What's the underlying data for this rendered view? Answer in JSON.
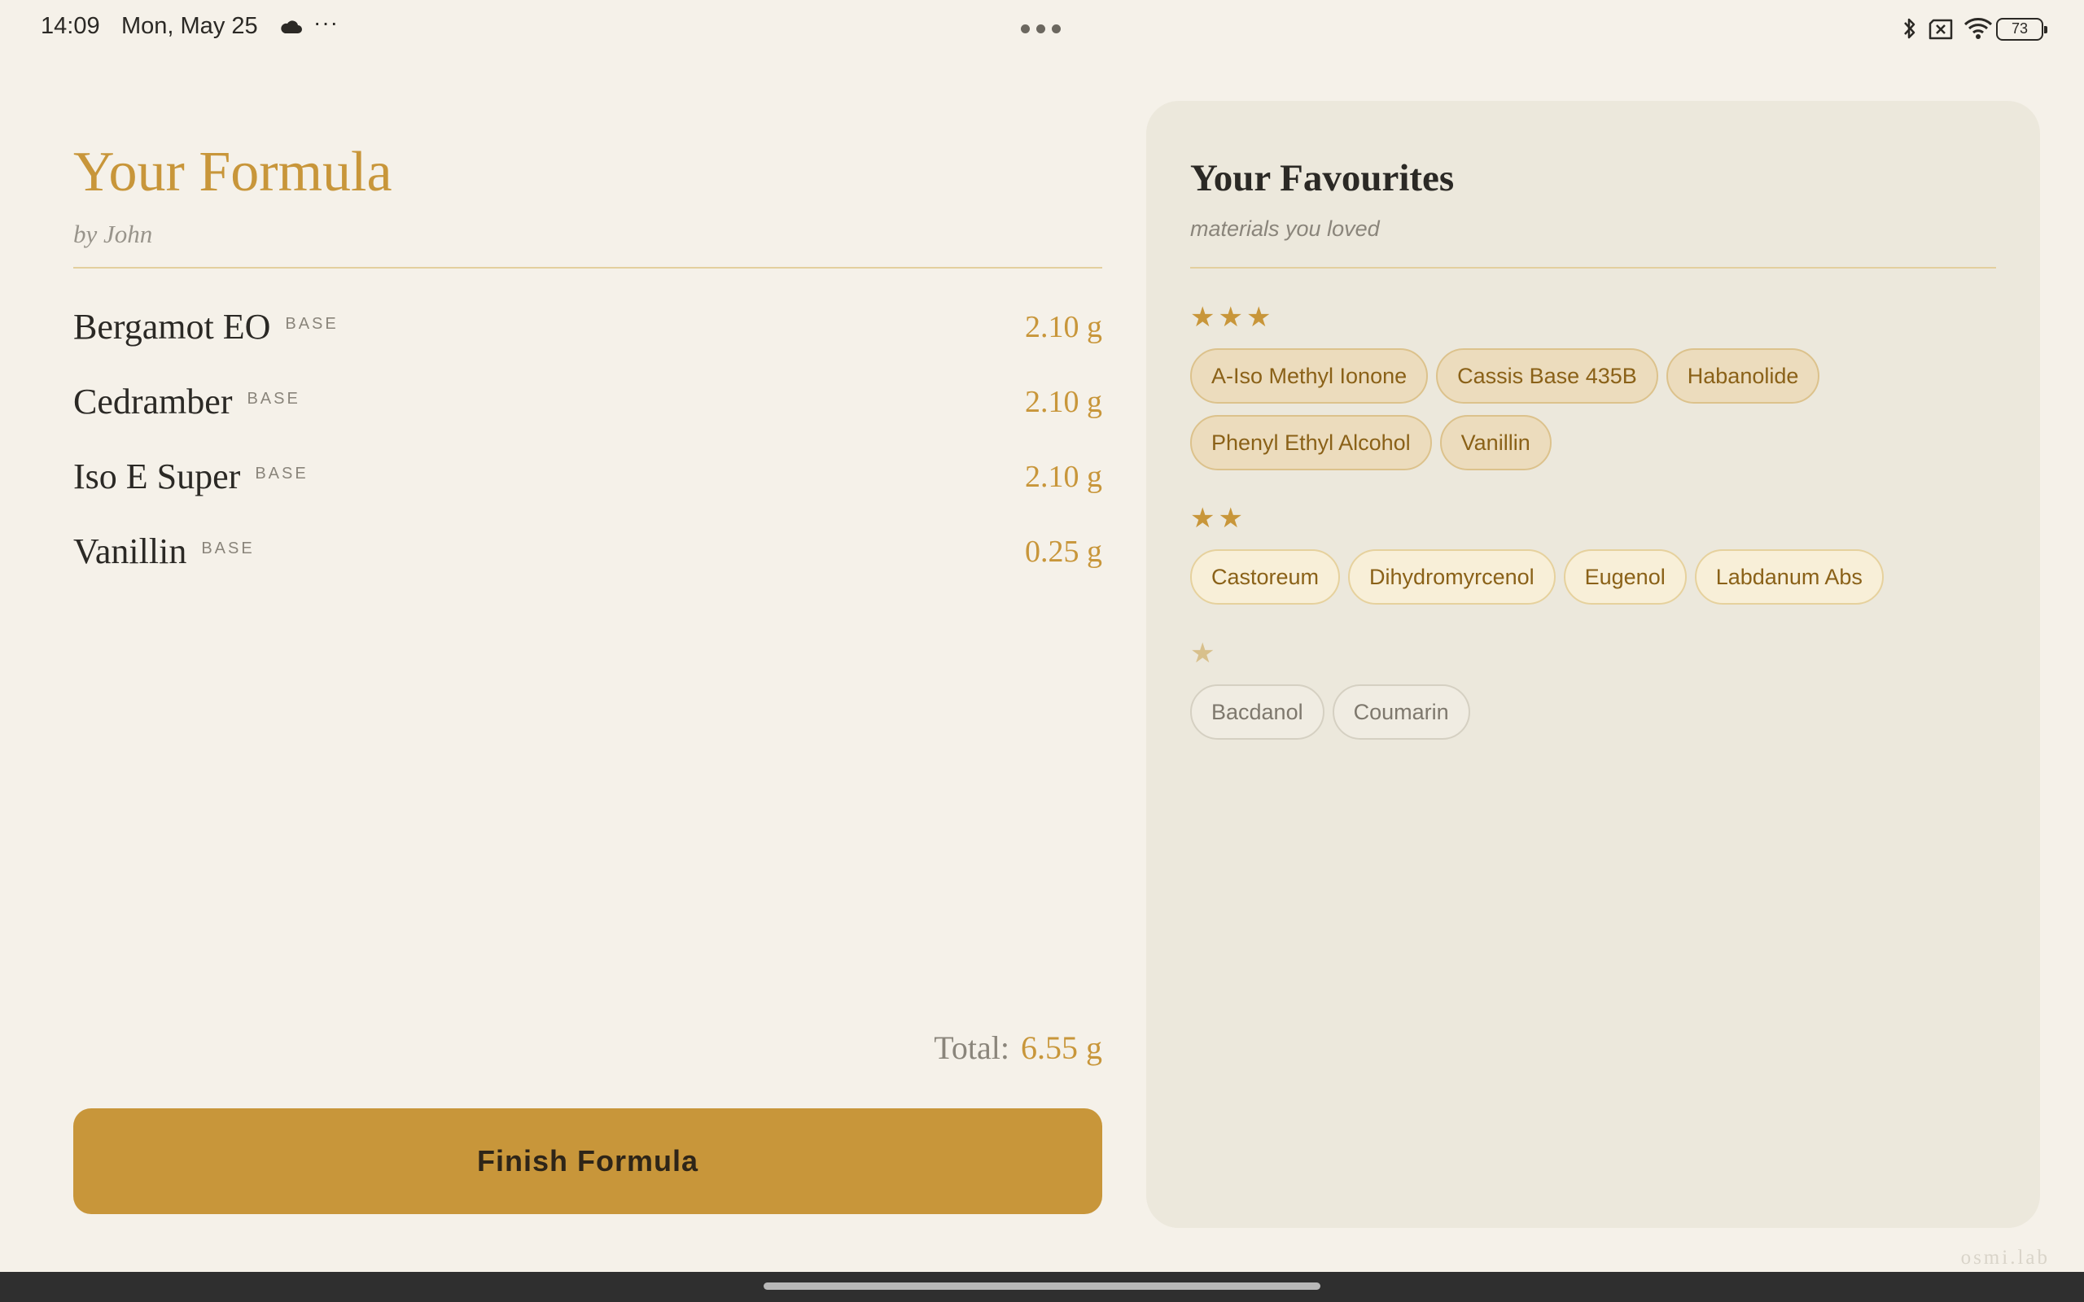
{
  "status_bar": {
    "time": "14:09",
    "date": "Mon, May 25",
    "weather_icon": "cloud-icon",
    "more": "···",
    "battery": "73",
    "icons": [
      "bluetooth-icon",
      "no-sim-icon",
      "wifi-icon",
      "battery-icon"
    ]
  },
  "formula": {
    "title": "Your Formula",
    "author": "by John",
    "items": [
      {
        "name": "Bergamot EO",
        "tag": "BASE",
        "amount": "2.10 g"
      },
      {
        "name": "Cedramber",
        "tag": "BASE",
        "amount": "2.10 g"
      },
      {
        "name": "Iso E Super",
        "tag": "BASE",
        "amount": "2.10 g"
      },
      {
        "name": "Vanillin",
        "tag": "BASE",
        "amount": "0.25 g"
      }
    ],
    "total_label": "Total:",
    "total_value": "6.55 g",
    "finish_label": "Finish Formula"
  },
  "favourites": {
    "title": "Your Favourites",
    "subtitle": "materials you loved",
    "groups": [
      {
        "stars": "★★★",
        "items": [
          "A-Iso Methyl Ionone",
          "Cassis Base 435B",
          "Habanolide",
          "Phenyl Ethyl Alcohol",
          "Vanillin"
        ]
      },
      {
        "stars": "★★",
        "items": [
          "Castoreum",
          "Dihydromyrcenol",
          "Eugenol",
          "Labdanum Abs"
        ]
      },
      {
        "stars": "★",
        "items": [
          "Bacdanol",
          "Coumarin"
        ]
      }
    ]
  },
  "watermark": "osmi.lab",
  "colors": {
    "background": "#f5f1e9",
    "accent": "#c8963a",
    "panel": "#ece8dc",
    "star_faded": "#d8c08c"
  }
}
